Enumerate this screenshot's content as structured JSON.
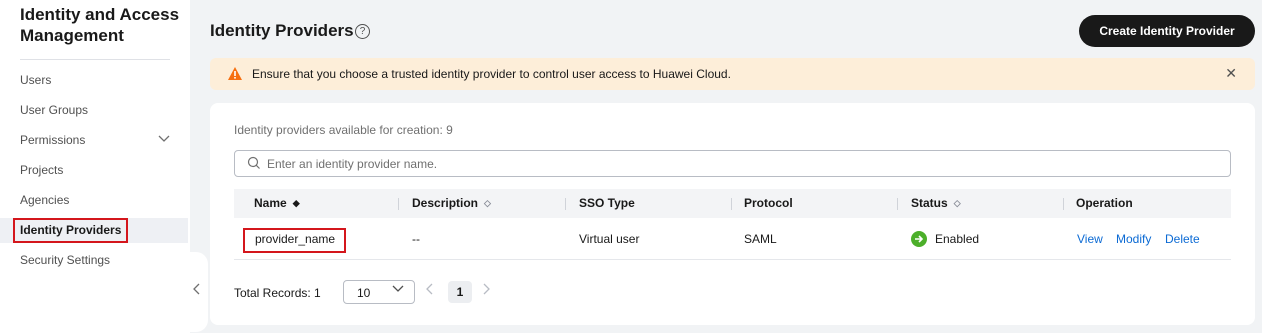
{
  "sidebar": {
    "title": "Identity and Access Management",
    "items": [
      {
        "label": "Users"
      },
      {
        "label": "User Groups"
      },
      {
        "label": "Permissions"
      },
      {
        "label": "Projects"
      },
      {
        "label": "Agencies"
      },
      {
        "label": "Identity Providers"
      },
      {
        "label": "Security Settings"
      }
    ],
    "active_item": "Identity Providers"
  },
  "header": {
    "title": "Identity Providers",
    "help_glyph": "?",
    "create_button": "Create Identity Provider"
  },
  "alert": {
    "text": "Ensure that you choose a trusted identity provider to control user access to Huawei Cloud.",
    "close_glyph": "✕"
  },
  "main": {
    "available_text": "Identity providers available for creation: 9",
    "search_placeholder": "Enter an identity provider name.",
    "table": {
      "columns": [
        "Name",
        "Description",
        "SSO Type",
        "Protocol",
        "Status",
        "Operation"
      ],
      "rows": [
        {
          "name": "provider_name",
          "description": "--",
          "sso_type": "Virtual user",
          "protocol": "SAML",
          "status": "Enabled",
          "operations": [
            "View",
            "Modify",
            "Delete"
          ]
        }
      ]
    },
    "pagination": {
      "total_label": "Total Records: 1",
      "page_size": "10",
      "current_page": "1"
    }
  },
  "colors": {
    "primary_button": "#191919",
    "alert_bg": "#fdeed9",
    "alert_icon": "#f66f0f",
    "link": "#0b6ad4",
    "status_enabled": "#4caf2a",
    "highlight_box": "#d4161c"
  }
}
